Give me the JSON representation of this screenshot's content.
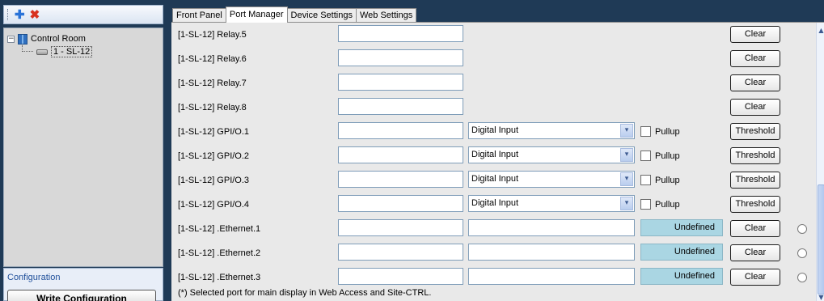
{
  "left": {
    "tree": {
      "root_label": "Control Room",
      "root_toggle": "−",
      "child_label": "1 - SL-12"
    },
    "config": {
      "label": "Configuration",
      "write_button": "Write Configuration"
    }
  },
  "tabs": [
    "Front Panel",
    "Port Manager",
    "Device Settings",
    "Web Settings"
  ],
  "rows": [
    {
      "name": "[1-SL-12] Relay.5",
      "type": "relay",
      "button": "Clear"
    },
    {
      "name": "[1-SL-12] Relay.6",
      "type": "relay",
      "button": "Clear"
    },
    {
      "name": "[1-SL-12] Relay.7",
      "type": "relay",
      "button": "Clear"
    },
    {
      "name": "[1-SL-12] Relay.8",
      "type": "relay",
      "button": "Clear"
    },
    {
      "name": "[1-SL-12] GPI/O.1",
      "type": "gpio",
      "select": "Digital Input",
      "check_label": "Pullup",
      "button": "Threshold"
    },
    {
      "name": "[1-SL-12] GPI/O.2",
      "type": "gpio",
      "select": "Digital Input",
      "check_label": "Pullup",
      "button": "Threshold"
    },
    {
      "name": "[1-SL-12] GPI/O.3",
      "type": "gpio",
      "select": "Digital Input",
      "check_label": "Pullup",
      "button": "Threshold"
    },
    {
      "name": "[1-SL-12] GPI/O.4",
      "type": "gpio",
      "select": "Digital Input",
      "check_label": "Pullup",
      "button": "Threshold"
    },
    {
      "name": "[1-SL-12] .Ethernet.1",
      "type": "ethernet",
      "status": "Undefined",
      "button": "Clear"
    },
    {
      "name": "[1-SL-12] .Ethernet.2",
      "type": "ethernet",
      "status": "Undefined",
      "button": "Clear"
    },
    {
      "name": "[1-SL-12] .Ethernet.3",
      "type": "ethernet",
      "status": "Undefined",
      "button": "Clear"
    }
  ],
  "footnote": "(*) Selected port for main display in Web Access and Site-CTRL.",
  "glyphs": {
    "dropdown": "▾",
    "scroll_up": "▲",
    "scroll_down": "▼",
    "add": "✚",
    "delete": "✖"
  }
}
